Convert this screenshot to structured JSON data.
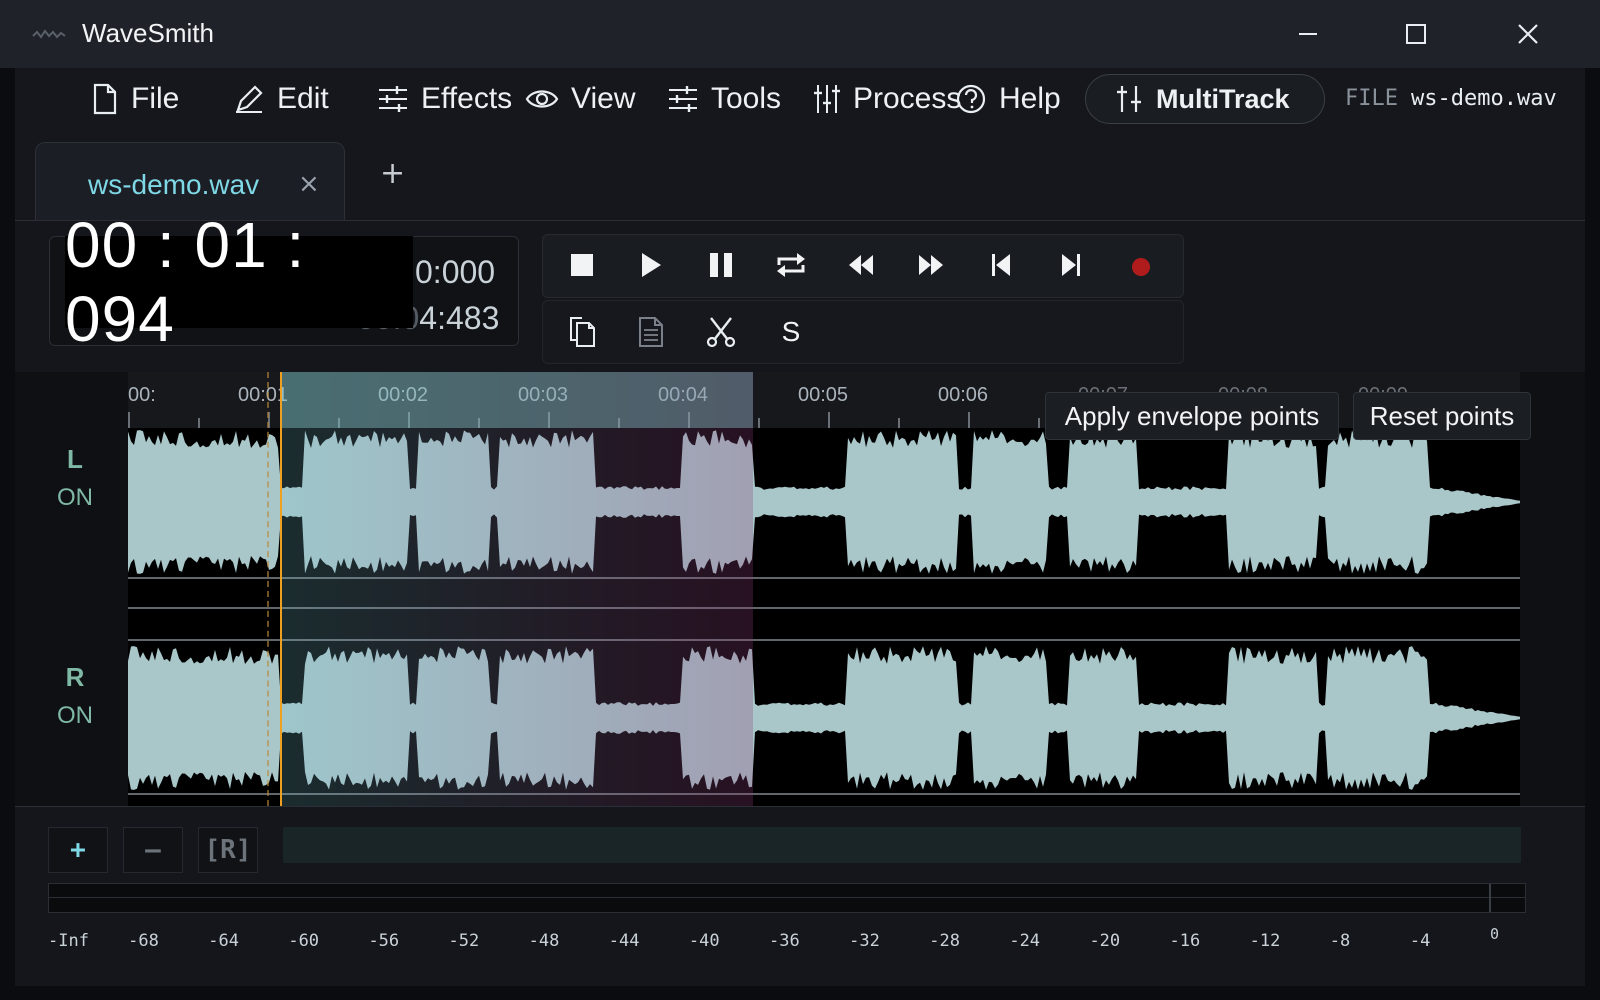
{
  "window": {
    "title": "WaveSmith"
  },
  "menu": {
    "items": [
      "File",
      "Edit",
      "Effects",
      "View",
      "Tools",
      "Process",
      "Help"
    ],
    "multitrack": "MultiTrack",
    "file_label": "FILE",
    "file_name": "ws-demo.wav"
  },
  "tabs": {
    "active": "ws-demo.wav",
    "close": "×",
    "add": "+"
  },
  "clock": {
    "main": "00 : 01 : 094",
    "sel_start": "0:000",
    "sel_end_dim": "00:0",
    "sel_end": "4:483"
  },
  "edit_tools": {
    "s_label": "S"
  },
  "ruler": {
    "ticks": [
      "00:",
      "00:01",
      "00:02",
      "00:03",
      "00:04",
      "00:05",
      "00:06",
      "00:07",
      "00:08",
      "00:09"
    ]
  },
  "channels": {
    "left": {
      "label": "L",
      "state": "ON"
    },
    "right": {
      "label": "R",
      "state": "ON"
    }
  },
  "envelope": {
    "apply": "Apply envelope points",
    "reset": "Reset points"
  },
  "zoom": {
    "in": "+",
    "out": "–",
    "reset": "[R]"
  },
  "meter": {
    "scale": [
      "-Inf",
      "-68",
      "-64",
      "-60",
      "-56",
      "-52",
      "-48",
      "-44",
      "-40",
      "-36",
      "-32",
      "-28",
      "-24",
      "-20",
      "-16",
      "-12",
      "-8",
      "-4",
      "0"
    ]
  },
  "colors": {
    "accent": "#7fd8e6",
    "record": "#b01c1c",
    "playhead": "#f0a020",
    "wave": "#a9c6c9"
  }
}
